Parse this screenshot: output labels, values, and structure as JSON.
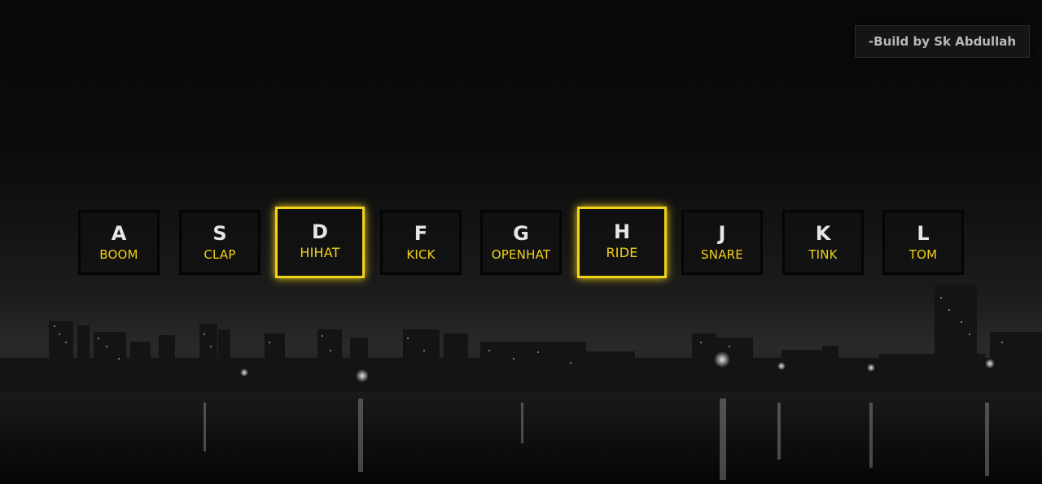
{
  "credit": {
    "text": "-Build by Sk Abdullah"
  },
  "keys": [
    {
      "letter": "A",
      "sound": "BOOM"
    },
    {
      "letter": "S",
      "sound": "CLAP"
    },
    {
      "letter": "D",
      "sound": "HIHAT"
    },
    {
      "letter": "F",
      "sound": "KICK"
    },
    {
      "letter": "G",
      "sound": "OPENHAT"
    },
    {
      "letter": "H",
      "sound": "RIDE"
    },
    {
      "letter": "J",
      "sound": "SNARE"
    },
    {
      "letter": "K",
      "sound": "TINK"
    },
    {
      "letter": "L",
      "sound": "TOM"
    }
  ],
  "highlight_color": "#f2d21a",
  "background": "night city skyline over water, grayscale"
}
